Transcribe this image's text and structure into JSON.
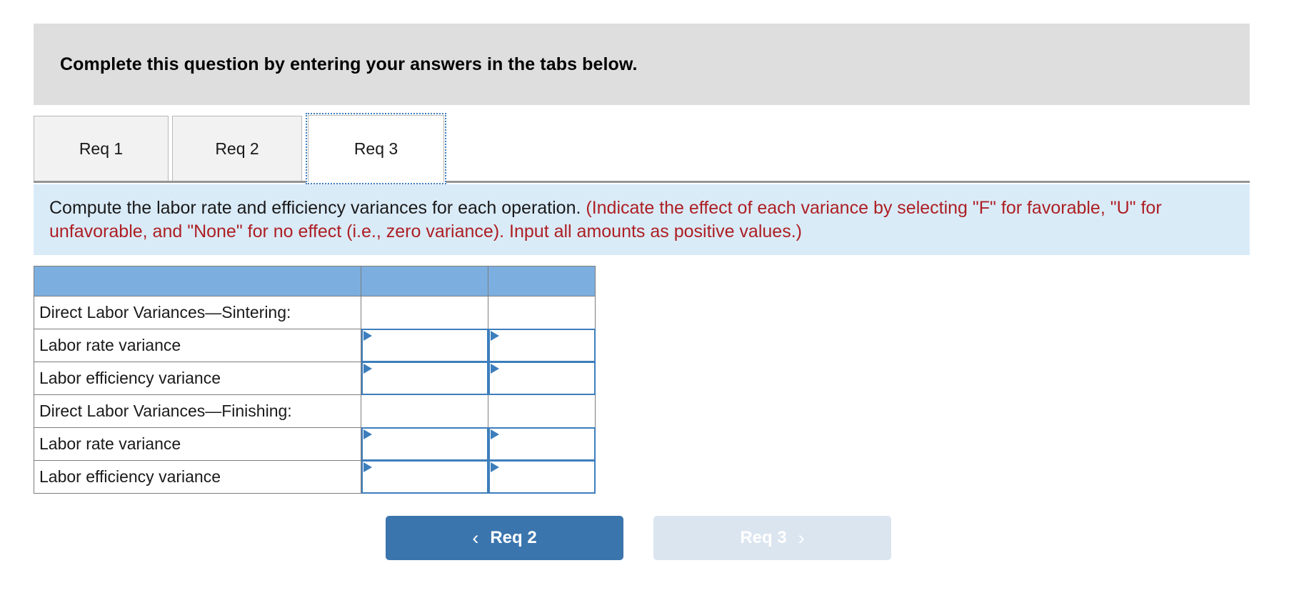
{
  "banner": {
    "title": "Complete this question by entering your answers in the tabs below."
  },
  "tabs": {
    "items": [
      {
        "label": "Req 1",
        "active": false
      },
      {
        "label": "Req 2",
        "active": false
      },
      {
        "label": "Req 3",
        "active": true
      }
    ]
  },
  "instruction": {
    "main": "Compute the labor rate and efficiency variances for each operation.",
    "note": "(Indicate the effect of each variance by selecting \"F\" for favorable, \"U\" for unfavorable, and \"None\" for no effect (i.e., zero variance). Input all amounts as positive values.)",
    "note_color": "#ad1f23",
    "background": "#daebf8"
  },
  "table": {
    "header_color": "#7cafe0",
    "headers": [
      "",
      "",
      ""
    ],
    "rows": [
      {
        "label": "Direct Labor Variances—Sintering:",
        "type": "section",
        "amount": "",
        "effect": ""
      },
      {
        "label": "Labor rate variance",
        "type": "input",
        "amount": "",
        "effect": ""
      },
      {
        "label": "Labor efficiency variance",
        "type": "input",
        "amount": "",
        "effect": ""
      },
      {
        "label": "Direct Labor Variances—Finishing:",
        "type": "section",
        "amount": "",
        "effect": ""
      },
      {
        "label": "Labor rate variance",
        "type": "input",
        "amount": "",
        "effect": ""
      },
      {
        "label": "Labor efficiency variance",
        "type": "input",
        "amount": "",
        "effect": ""
      }
    ]
  },
  "nav": {
    "prev_label": "Req 2",
    "prev_icon": "chevron-left-icon",
    "prev_color": "#3b75ad",
    "next_label": "Req 3",
    "next_icon": "chevron-right-icon",
    "next_color": "#dbe5f0",
    "chevron_left": "‹",
    "chevron_right": "›"
  }
}
